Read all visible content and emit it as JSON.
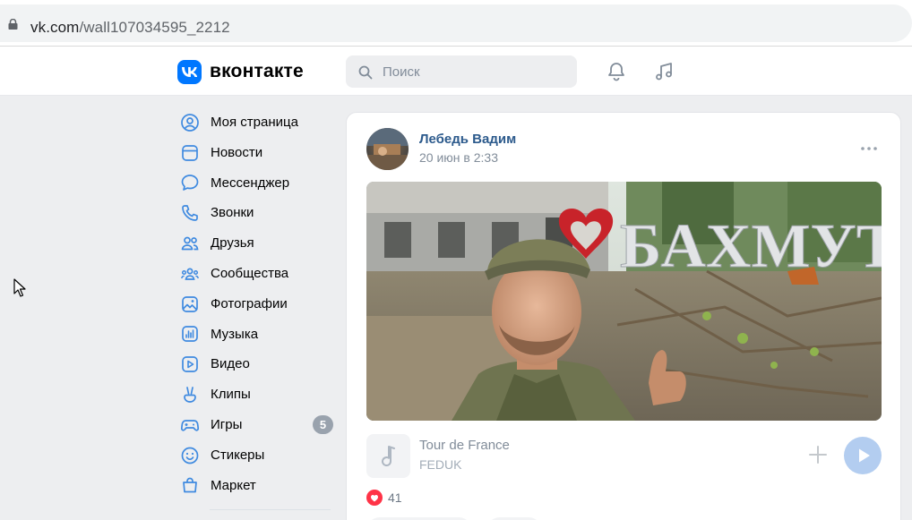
{
  "browser": {
    "url_host": "vk.com",
    "url_path": "/wall107034595_2212"
  },
  "header": {
    "logo_text": "вконтакте",
    "search_placeholder": "Поиск"
  },
  "sidebar": {
    "items": [
      {
        "label": "Моя страница",
        "icon": "user-circle-icon"
      },
      {
        "label": "Новости",
        "icon": "news-icon"
      },
      {
        "label": "Мессенджер",
        "icon": "message-icon"
      },
      {
        "label": "Звонки",
        "icon": "phone-icon"
      },
      {
        "label": "Друзья",
        "icon": "friends-icon"
      },
      {
        "label": "Сообщества",
        "icon": "communities-icon"
      },
      {
        "label": "Фотографии",
        "icon": "photo-icon"
      },
      {
        "label": "Музыка",
        "icon": "music-icon"
      },
      {
        "label": "Видео",
        "icon": "video-icon"
      },
      {
        "label": "Клипы",
        "icon": "clips-icon"
      },
      {
        "label": "Игры",
        "icon": "games-icon",
        "badge": "5"
      },
      {
        "label": "Стикеры",
        "icon": "stickers-icon"
      },
      {
        "label": "Маркет",
        "icon": "market-icon"
      }
    ]
  },
  "post": {
    "author": "Лебедь Вадим",
    "date": "20 июн в 2:33",
    "photo_sign_text": "БАХМУТ",
    "audio": {
      "title": "Tour de France",
      "artist": "FEDUK"
    },
    "likes_count": "41"
  },
  "colors": {
    "brand": "#0077ff",
    "link": "#2c5a8c",
    "muted": "#818c99",
    "page_bg": "#edeef0"
  }
}
